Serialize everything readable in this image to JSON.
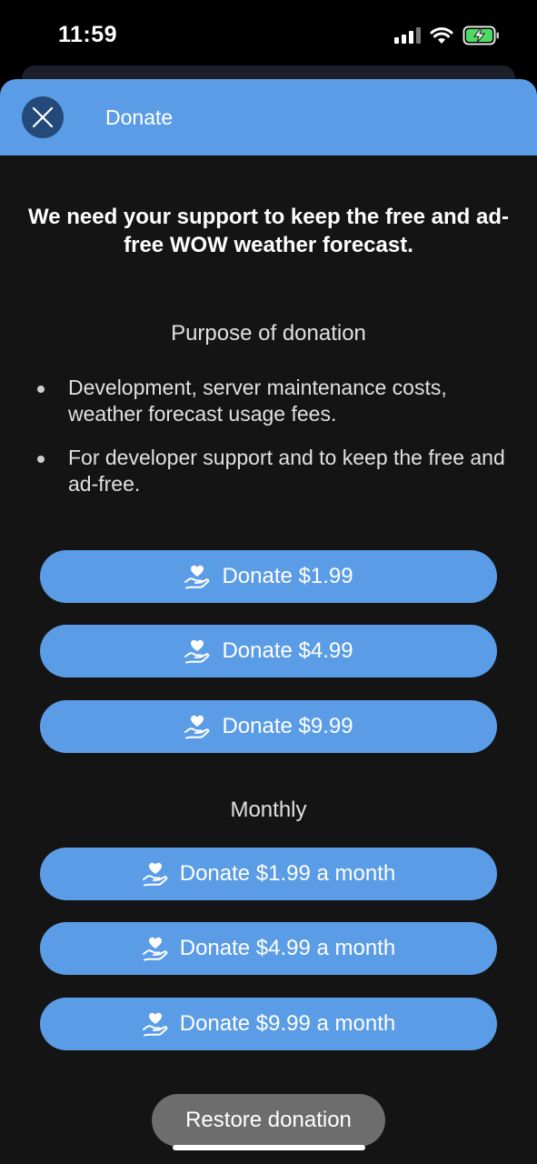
{
  "status_bar": {
    "time": "11:59",
    "icons": [
      "cellular-signal-icon",
      "wifi-icon",
      "battery-charging-icon"
    ],
    "battery_color": "#4cd964"
  },
  "header": {
    "title": "Donate",
    "close_icon": "close-icon",
    "background": "#5b9ce6"
  },
  "intro": "We need your support to keep the free and ad-free WOW weather forecast.",
  "purpose": {
    "title": "Purpose of donation",
    "items": [
      "Development, server maintenance costs, weather forecast usage fees.",
      "For developer support and to keep the free and ad-free."
    ]
  },
  "one_time": {
    "icon": "hand-heart-icon",
    "buttons": [
      "Donate $1.99",
      "Donate $4.99",
      "Donate $9.99"
    ]
  },
  "monthly": {
    "title": "Monthly",
    "icon": "hand-heart-icon",
    "buttons": [
      "Donate $1.99 a month",
      "Donate $4.99 a month",
      "Donate $9.99 a month"
    ]
  },
  "restore": {
    "label": "Restore donation"
  },
  "colors": {
    "accent": "#5b9ce6",
    "close_button_bg": "#234a7a",
    "sheet_bg": "#141414",
    "restore_bg": "#6d6d6d"
  }
}
